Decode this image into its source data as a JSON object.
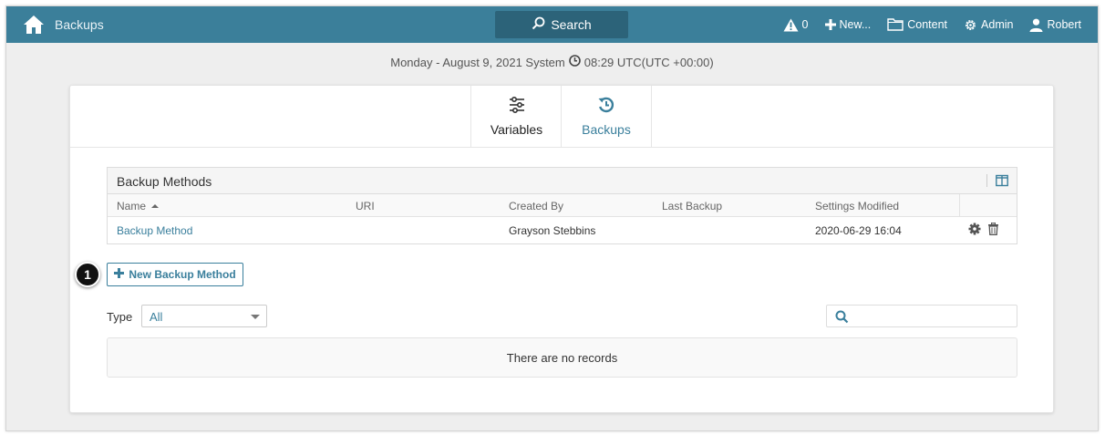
{
  "navbar": {
    "title": "Backups",
    "search_label": "Search",
    "alerts_count": "0",
    "new_label": "New...",
    "content_label": "Content",
    "admin_label": "Admin",
    "user_name": "Robert",
    "icons": [
      "home-icon",
      "search-icon",
      "warning-icon",
      "plus-icon",
      "folder-icon",
      "gear-icon",
      "user-icon"
    ],
    "colors": {
      "bar": "#3b7f9a",
      "search_bg": "#2c6379"
    }
  },
  "datetime": {
    "prefix": "Monday - August 9, 2021 System",
    "time": "08:29 UTC(UTC +00:00)"
  },
  "tabs": [
    {
      "label": "Variables",
      "icon": "sliders-icon",
      "active": false
    },
    {
      "label": "Backups",
      "icon": "history-icon",
      "active": true
    }
  ],
  "panel": {
    "title": "Backup Methods",
    "columns": [
      "Name",
      "URI",
      "Created By",
      "Last Backup",
      "Settings Modified"
    ],
    "sort_column": "Name",
    "rows": [
      {
        "name": "Backup Method",
        "uri": "",
        "created_by": "Grayson Stebbins",
        "last_backup": "",
        "settings_modified": "2020-06-29 16:04"
      }
    ]
  },
  "new_button_label": "New Backup Method",
  "callout_number": "1",
  "filter": {
    "label": "Type",
    "selected": "All"
  },
  "search": {
    "placeholder": ""
  },
  "empty_message": "There are no records",
  "accent_color": "#3a7f9c"
}
